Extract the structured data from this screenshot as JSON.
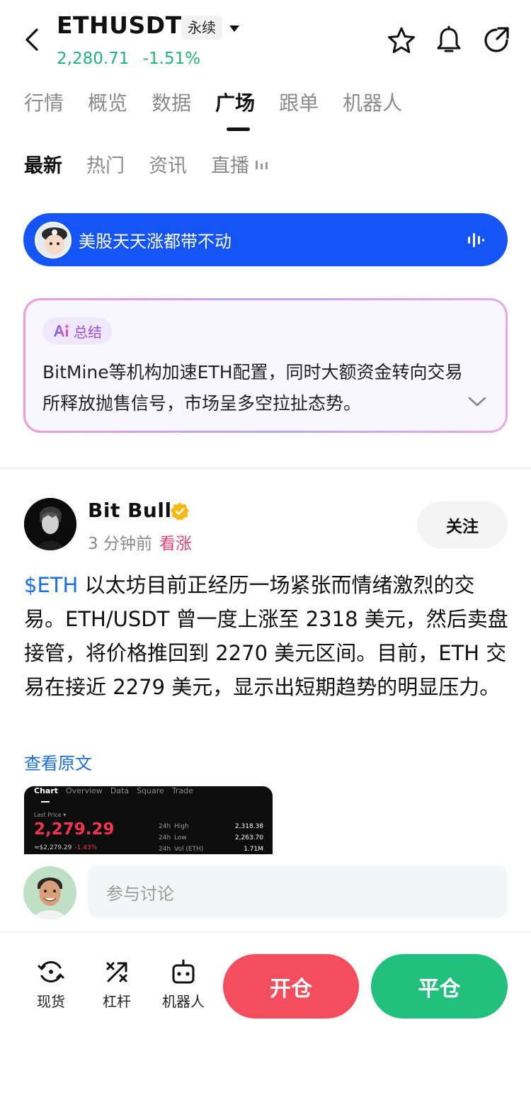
{
  "header": {
    "symbol": "ETHUSDT",
    "contract_type": "永续",
    "last_price": "2,280.71",
    "change_pct": "-1.51%"
  },
  "main_tabs": [
    {
      "label": "行情"
    },
    {
      "label": "概览"
    },
    {
      "label": "数据"
    },
    {
      "label": "广场",
      "active": true
    },
    {
      "label": "跟单"
    },
    {
      "label": "机器人"
    }
  ],
  "sub_tabs": [
    {
      "label": "最新",
      "active": true
    },
    {
      "label": "热门"
    },
    {
      "label": "资讯"
    },
    {
      "label": "直播"
    }
  ],
  "live_banner": {
    "text": "美股天天涨都带不动",
    "color": "#1555f6"
  },
  "ai_summary": {
    "badge": "总结",
    "text": "BitMine等机构加速ETH配置，同时大额资金转向交易所释放抛售信号，市场呈多空拉扯态势。"
  },
  "post": {
    "author": "Bit  Bull",
    "time": "3 分钟前",
    "sentiment": "看涨",
    "follow_label": "关注",
    "ticker": "$ETH",
    "body": " 以太坊目前正经历一场紧张而情绪激烈的交易。ETH/USDT 曾一度上涨至 2318 美元，然后卖盘接管，将价格推回到 2270 美元区间。目前，ETH 交易在接近 2279 美元，显示出短期趋势的明显压力。",
    "view_original": "查看原文",
    "image": {
      "tabs": [
        "Chart",
        "Overview",
        "Data",
        "Square",
        "Trade"
      ],
      "last_price_label": "Last Price ▾",
      "price": "2,279.29",
      "usd_value": "≈$2,279.29",
      "change": "-1.43%",
      "stats": [
        {
          "period": "24h",
          "label": "High",
          "value": "2,318.38"
        },
        {
          "period": "24h",
          "label": "Low",
          "value": "2,263.70"
        },
        {
          "period": "24h",
          "label": "Vol (ETH)",
          "value": "1.71M"
        }
      ]
    }
  },
  "comment": {
    "placeholder": "参与讨论"
  },
  "bottom_bar": {
    "spot_label": "现货",
    "margin_label": "杠杆",
    "bot_label": "机器人",
    "open_label": "开仓",
    "close_label": "平仓",
    "open_color": "#f34d5e",
    "close_color": "#21c07c"
  }
}
